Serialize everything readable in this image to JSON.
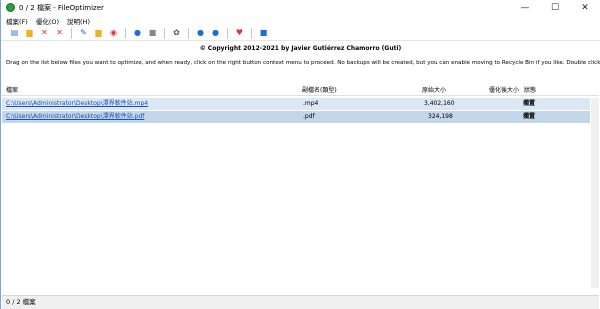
{
  "window": {
    "title": "0 / 2 檔案 - FileOptimizer"
  },
  "menu": {
    "items": [
      "檔案(F)",
      "優化(O)",
      "說明(H)"
    ]
  },
  "toolbar": {
    "buttons": [
      {
        "name": "add-files-icon",
        "glyph": "▤",
        "color": "#3a7bd5"
      },
      {
        "name": "add-folder-icon",
        "glyph": "▆",
        "color": "#e8b623"
      },
      {
        "name": "remove-icon",
        "glyph": "✕",
        "color": "#d33"
      },
      {
        "name": "clear-icon",
        "glyph": "✕",
        "color": "#d33"
      },
      {
        "name": "edit-icon",
        "glyph": "✎",
        "color": "#2c62c9"
      },
      {
        "name": "open-folder-icon",
        "glyph": "▆",
        "color": "#e8b623"
      },
      {
        "name": "stop-icon",
        "glyph": "◉",
        "color": "#d33"
      },
      {
        "name": "play-icon",
        "glyph": "●",
        "color": "#1e6fd1"
      },
      {
        "name": "pause-icon",
        "glyph": "■",
        "color": "#888"
      },
      {
        "name": "settings-icon",
        "glyph": "✿",
        "color": "#555"
      },
      {
        "name": "help-icon",
        "glyph": "●",
        "color": "#1e6fd1"
      },
      {
        "name": "update-icon",
        "glyph": "●",
        "color": "#1e6fd1"
      },
      {
        "name": "donate-icon",
        "glyph": "♥",
        "color": "#d33"
      },
      {
        "name": "info-icon",
        "glyph": "■",
        "color": "#1e6fd1"
      }
    ]
  },
  "copyright": "© Copyright 2012-2021 by Javier Gutiérrez Chamorro (Guti)",
  "instructions": "Drag on the list below files you want to optimize, and when ready, click on the right button context menu to proceed. No backups will be created, but you can enable moving to Recycle Bin if you like. Double click an item to preview it.",
  "list": {
    "headers": {
      "file": "檔案",
      "ext": "副檔名(類型)",
      "orig_size": "原始大小",
      "opt_size": "優化後大小",
      "status": "狀態"
    },
    "rows": [
      {
        "file": "C:\\Users\\Administrator\\Desktop\\潭界軟件站.mp4",
        "ext": ".mp4",
        "orig_size": "3,402,160",
        "status": "擱置"
      },
      {
        "file": "C:\\Users\\Administrator\\Desktop\\潭界軟件站.pdf",
        "ext": ".pdf",
        "orig_size": "324,198",
        "status": "擱置"
      }
    ]
  },
  "statusbar": {
    "text": "0 / 2 檔案"
  }
}
